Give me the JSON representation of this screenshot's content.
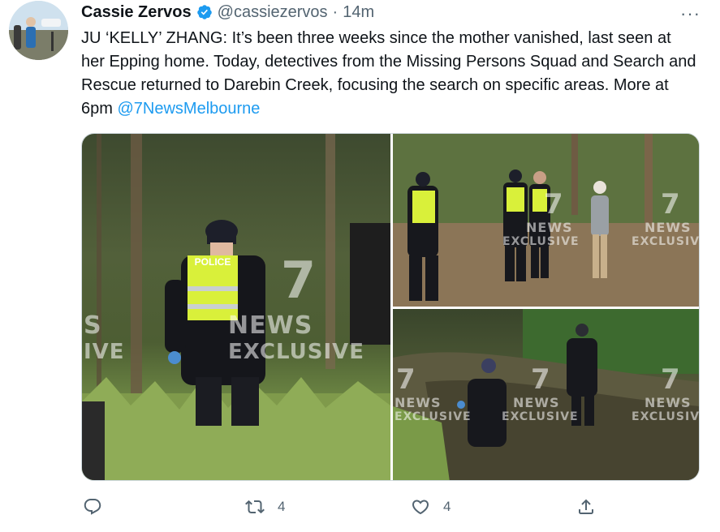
{
  "tweet": {
    "author_name": "Cassie Zervos",
    "handle": "@cassiezervos",
    "separator": "·",
    "time": "14m",
    "more_label": "···",
    "text_main": "JU ‘KELLY’ ZHANG: It’s been three weeks since the mother vanished,  last seen at her Epping home. Today, detectives from the Missing Persons Squad and Search and Rescue returned to Darebin Creek, focusing the search on specific areas. More at 6pm ",
    "mention": "@7NewsMelbourne"
  },
  "media": {
    "watermark_number": "7",
    "watermark_news": "NEWS",
    "watermark_exclusive": "EXCLUSIVE",
    "photo1_partial_news": "S",
    "photo1_partial_exclusive": "IVE",
    "police_vest_text": "POLICE"
  },
  "actions": {
    "reply_count": "",
    "retweet_count": "4",
    "like_count": "4"
  },
  "colors": {
    "accent": "#1d9bf0",
    "muted": "#536471",
    "text": "#0f1419"
  },
  "icons": [
    "verified-badge-icon",
    "more-icon",
    "reply-icon",
    "retweet-icon",
    "like-icon",
    "share-icon"
  ]
}
